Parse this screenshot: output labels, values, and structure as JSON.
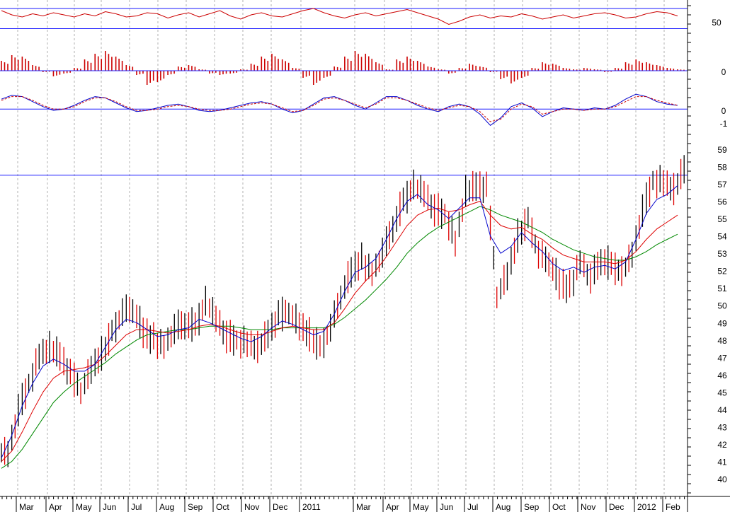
{
  "chart_data": {
    "type": "line",
    "title": "",
    "x_labels": [
      "Mar",
      "Apr",
      "May",
      "Jun",
      "Jul",
      "Aug",
      "Sep",
      "Oct",
      "Nov",
      "Dec",
      "2011",
      "Mar",
      "Apr",
      "May",
      "Jun",
      "Jul",
      "Aug",
      "Sep",
      "Oct",
      "Nov",
      "Dec",
      "2012",
      "Feb"
    ],
    "panels": [
      {
        "name": "rsi",
        "type": "line",
        "y_ticks": [
          "50"
        ],
        "reference_lines": [
          62,
          43
        ],
        "series": [
          {
            "color": "#cc0000",
            "values": [
              60,
              56,
              54,
              57,
              55,
              58,
              56,
              54,
              57,
              55,
              59,
              57,
              54,
              55,
              58,
              57,
              53,
              56,
              58,
              54,
              57,
              60,
              55,
              52,
              56,
              58,
              55,
              54,
              57,
              60,
              62,
              58,
              55,
              53,
              56,
              58,
              55,
              57,
              59,
              61,
              58,
              55,
              52,
              47,
              50,
              54,
              56,
              53,
              55,
              54,
              57,
              55,
              52,
              54,
              56,
              53,
              55,
              57,
              58,
              56,
              53,
              54,
              57,
              59,
              58,
              55
            ]
          }
        ]
      },
      {
        "name": "macd-histogram",
        "type": "bar",
        "y_ticks": [
          "0"
        ],
        "reference_lines": [
          0
        ],
        "series": [
          {
            "color": "#cc0000",
            "values": [
              1.4,
              2.2,
              2.0,
              0.8,
              -0.2,
              -0.8,
              -0.4,
              0.4,
              1.6,
              2.4,
              2.8,
              2.0,
              0.8,
              -0.6,
              -2.0,
              -1.6,
              -0.6,
              0.6,
              0.8,
              0.2,
              -0.4,
              -0.6,
              -0.4,
              0.2,
              1.0,
              2.0,
              2.4,
              1.6,
              0.4,
              -1.0,
              -2.0,
              -1.0,
              0.6,
              2.0,
              2.8,
              2.4,
              1.2,
              0.2,
              1.6,
              2.0,
              1.4,
              0.6,
              0.2,
              -0.4,
              0.4,
              1.0,
              0.6,
              -0.2,
              -1.2,
              -1.8,
              -1.0,
              0.4,
              1.2,
              1.0,
              0.4,
              0.2,
              0.4,
              0.2,
              -0.2,
              0.4,
              1.2,
              1.6,
              1.2,
              0.8,
              0.4,
              0.2
            ]
          }
        ]
      },
      {
        "name": "macd",
        "type": "line",
        "y_ticks": [
          "0",
          "-1"
        ],
        "reference_lines": [
          0
        ],
        "series": [
          {
            "color": "#0000cc",
            "values": [
              0.8,
              1.1,
              1.0,
              0.6,
              0.2,
              -0.1,
              0.0,
              0.3,
              0.7,
              1.0,
              0.9,
              0.5,
              0.1,
              -0.2,
              -0.1,
              0.1,
              0.3,
              0.4,
              0.2,
              -0.1,
              -0.2,
              -0.1,
              0.1,
              0.3,
              0.5,
              0.6,
              0.4,
              0.0,
              -0.3,
              -0.1,
              0.4,
              0.9,
              1.0,
              0.7,
              0.3,
              0.0,
              0.5,
              1.0,
              1.0,
              0.7,
              0.3,
              0.0,
              -0.2,
              0.2,
              0.4,
              0.2,
              -0.4,
              -1.3,
              -0.7,
              0.2,
              0.5,
              0.1,
              -0.6,
              -0.2,
              0.1,
              0.0,
              -0.1,
              0.1,
              0.0,
              0.3,
              0.8,
              1.2,
              1.0,
              0.6,
              0.4,
              0.3
            ]
          },
          {
            "color": "#cc0000",
            "values": [
              0.7,
              1.0,
              1.0,
              0.7,
              0.3,
              0.0,
              0.0,
              0.2,
              0.6,
              0.9,
              0.9,
              0.6,
              0.2,
              -0.1,
              -0.1,
              0.0,
              0.2,
              0.3,
              0.2,
              0.0,
              -0.1,
              -0.1,
              0.0,
              0.2,
              0.4,
              0.5,
              0.4,
              0.1,
              -0.2,
              -0.1,
              0.3,
              0.8,
              0.9,
              0.7,
              0.4,
              0.1,
              0.4,
              0.9,
              0.9,
              0.7,
              0.4,
              0.1,
              -0.1,
              0.1,
              0.3,
              0.2,
              -0.2,
              -1.0,
              -0.8,
              0.0,
              0.4,
              0.2,
              -0.4,
              -0.2,
              0.0,
              0.0,
              -0.1,
              0.0,
              0.0,
              0.2,
              0.6,
              1.0,
              1.0,
              0.7,
              0.5,
              0.3
            ]
          }
        ]
      },
      {
        "name": "price",
        "type": "ohlc",
        "y_ticks": [
          "59",
          "58",
          "57",
          "56",
          "55",
          "54",
          "53",
          "52",
          "51",
          "50",
          "49",
          "48",
          "47",
          "46",
          "45",
          "44",
          "43",
          "42",
          "41",
          "40"
        ],
        "ylim": [
          39.6,
          59.6
        ],
        "reference_lines": [
          57.5
        ],
        "close": [
          41.5,
          44.0,
          45.5,
          47.0,
          47.5,
          47.2,
          46.0,
          45.0,
          46.3,
          47.2,
          48.5,
          49.5,
          49.8,
          48.5,
          48.0,
          47.6,
          48.6,
          49.0,
          48.8,
          50.1,
          49.3,
          48.2,
          48.0,
          47.7,
          47.5,
          48.5,
          49.4,
          49.6,
          48.8,
          48.3,
          47.6,
          48.6,
          50.6,
          52.0,
          52.6,
          51.8,
          53.0,
          54.6,
          56.0,
          56.8,
          56.5,
          55.5,
          55.3,
          53.5,
          56.5,
          57.0,
          56.8,
          50.5,
          51.7,
          54.0,
          55.0,
          52.8,
          52.5,
          51.3,
          51.0,
          52.5,
          51.5,
          52.7,
          52.3,
          51.8,
          53.0,
          55.5,
          57.2,
          57.0,
          56.6,
          58.0
        ],
        "ma_blue": [
          41.2,
          42.5,
          44.2,
          45.5,
          46.5,
          46.9,
          46.6,
          46.2,
          46.2,
          46.6,
          47.6,
          48.6,
          49.2,
          49.0,
          48.6,
          48.2,
          48.3,
          48.6,
          48.7,
          49.2,
          49.0,
          48.7,
          48.4,
          48.1,
          47.9,
          48.2,
          48.7,
          49.1,
          48.9,
          48.6,
          48.3,
          48.5,
          49.5,
          50.8,
          51.9,
          52.2,
          52.7,
          53.8,
          55.0,
          56.0,
          56.4,
          55.8,
          55.5,
          55.0,
          55.6,
          56.2,
          56.2,
          54.0,
          53.0,
          53.4,
          54.2,
          53.6,
          53.1,
          52.4,
          52.0,
          52.2,
          51.9,
          52.2,
          52.3,
          52.1,
          52.5,
          53.8,
          55.3,
          56.1,
          56.4,
          56.9
        ],
        "ma_red": [
          41.0,
          41.6,
          42.7,
          43.9,
          45.0,
          45.8,
          46.2,
          46.3,
          46.4,
          46.6,
          47.1,
          47.7,
          48.3,
          48.6,
          48.6,
          48.5,
          48.4,
          48.5,
          48.6,
          48.8,
          48.9,
          48.8,
          48.6,
          48.4,
          48.3,
          48.3,
          48.5,
          48.7,
          48.8,
          48.7,
          48.6,
          48.6,
          49.0,
          49.8,
          50.7,
          51.4,
          52.0,
          52.8,
          53.7,
          54.6,
          55.2,
          55.5,
          55.6,
          55.4,
          55.5,
          55.8,
          56.0,
          55.2,
          54.6,
          54.4,
          54.5,
          54.1,
          53.8,
          53.3,
          52.9,
          52.7,
          52.5,
          52.5,
          52.5,
          52.4,
          52.6,
          53.1,
          53.8,
          54.4,
          54.8,
          55.2
        ],
        "ma_green": [
          40.6,
          41.0,
          41.7,
          42.6,
          43.5,
          44.4,
          45.0,
          45.5,
          45.9,
          46.3,
          46.7,
          47.2,
          47.6,
          48.0,
          48.3,
          48.4,
          48.5,
          48.6,
          48.6,
          48.7,
          48.8,
          48.8,
          48.8,
          48.7,
          48.6,
          48.6,
          48.6,
          48.7,
          48.7,
          48.7,
          48.7,
          48.7,
          48.9,
          49.3,
          49.8,
          50.3,
          50.9,
          51.5,
          52.2,
          53.0,
          53.6,
          54.1,
          54.5,
          54.8,
          55.1,
          55.4,
          55.7,
          55.5,
          55.2,
          55.0,
          54.8,
          54.5,
          54.2,
          53.8,
          53.5,
          53.2,
          53.0,
          52.8,
          52.7,
          52.6,
          52.6,
          52.8,
          53.1,
          53.5,
          53.8,
          54.1
        ]
      }
    ]
  }
}
